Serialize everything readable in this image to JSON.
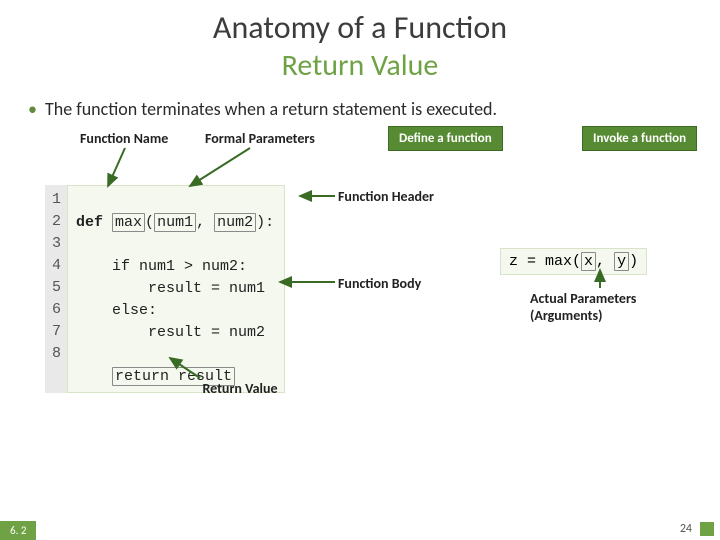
{
  "title_line1": "Anatomy of a Function",
  "title_line2": "Return Value",
  "bullet_text": "The function terminates when a return statement is executed.",
  "labels": {
    "function_name": "Function Name",
    "formal_parameters": "Formal Parameters",
    "define": "Define a function",
    "invoke": "Invoke a function",
    "function_header": "Function Header",
    "function_body": "Function Body",
    "actual_parameters_l1": "Actual Parameters",
    "actual_parameters_l2": "(Arguments)",
    "return_value": "Return Value"
  },
  "code": {
    "line_numbers": [
      "1",
      "2",
      "3",
      "4",
      "5",
      "6",
      "7",
      "8"
    ],
    "def_kw": "def",
    "fn_name": "max",
    "param1": "num1",
    "param2": "num2",
    "body_if": "    if num1 > num2:",
    "body_r1": "        result = num1",
    "body_else": "    else:",
    "body_r2": "        result = num2",
    "blank": "",
    "return_stmt": "return result"
  },
  "invoke": {
    "prefix": "z = max",
    "arg1": "x",
    "arg2": "y"
  },
  "footer": {
    "section": "6. 2",
    "page": "24"
  }
}
